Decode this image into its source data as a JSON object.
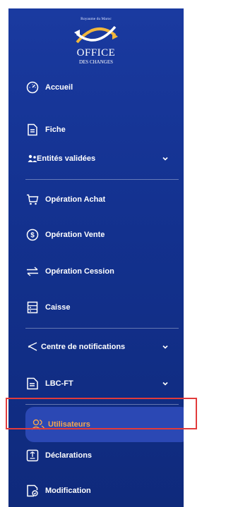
{
  "logo": {
    "kingdom": "Royaume du Maroc",
    "name_line1": "OFFICE",
    "name_line2": "DES CHANGES"
  },
  "menu": [
    {
      "label": "Accueil",
      "icon": "dashboard-gauge-icon"
    },
    {
      "label": "Fiche",
      "icon": "document-icon"
    },
    {
      "label": "Entités validées",
      "icon": "group-icon",
      "expandable": true
    },
    {
      "label": "Opération Achat",
      "icon": "cart-icon"
    },
    {
      "label": "Opération Vente",
      "icon": "dollar-circle-icon"
    },
    {
      "label": "Opération Cession",
      "icon": "transfer-arrows-icon"
    },
    {
      "label": "Caisse",
      "icon": "cash-register-icon"
    },
    {
      "label": "Centre de notifications",
      "icon": "megaphone-icon",
      "expandable": true
    },
    {
      "label": "LBC-FT",
      "icon": "document-icon",
      "expandable": true
    },
    {
      "label": "Utilisateurs",
      "icon": "users-icon",
      "active": true
    },
    {
      "label": "Déclarations",
      "icon": "declaration-icon"
    },
    {
      "label": "Modification",
      "icon": "edit-document-icon"
    }
  ],
  "colors": {
    "sidebar_top": "#1a3aa0",
    "sidebar_bottom": "#0f2a7c",
    "active_bg": "#2b48b4",
    "active_text": "#f5a64e",
    "highlight_border": "#e23b3b"
  }
}
